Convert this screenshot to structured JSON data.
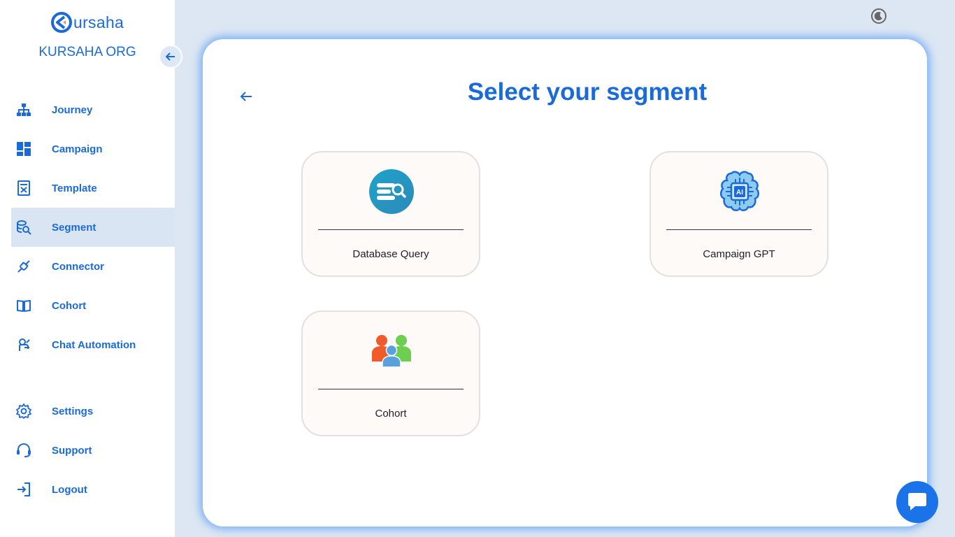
{
  "app": {
    "logo_text": "ursaha",
    "org_name": "KURSAHA ORG"
  },
  "colors": {
    "brand": "#1a6bd8",
    "active_bg": "#d9e5f3",
    "page_bg": "#dde7f3",
    "panel_glow": "#2882f5"
  },
  "sidebar": {
    "items": [
      {
        "label": "Journey",
        "icon": "sitemap-icon"
      },
      {
        "label": "Campaign",
        "icon": "dashboard-grid-icon"
      },
      {
        "label": "Template",
        "icon": "template-icon"
      },
      {
        "label": "Segment",
        "icon": "database-search-icon",
        "active": true
      },
      {
        "label": "Connector",
        "icon": "plug-icon"
      },
      {
        "label": "Cohort",
        "icon": "book-icon"
      },
      {
        "label": "Chat Automation",
        "icon": "robot-hand-icon"
      }
    ],
    "bottom_items": [
      {
        "label": "Settings",
        "icon": "gear-icon"
      },
      {
        "label": "Support",
        "icon": "headset-icon"
      },
      {
        "label": "Logout",
        "icon": "logout-icon"
      }
    ]
  },
  "main": {
    "title": "Select your segment",
    "cards": [
      {
        "label": "Database Query",
        "icon": "database-query-icon"
      },
      {
        "label": "Campaign GPT",
        "icon": "ai-chip-icon"
      },
      {
        "label": "Cohort",
        "icon": "people-group-icon"
      }
    ]
  }
}
